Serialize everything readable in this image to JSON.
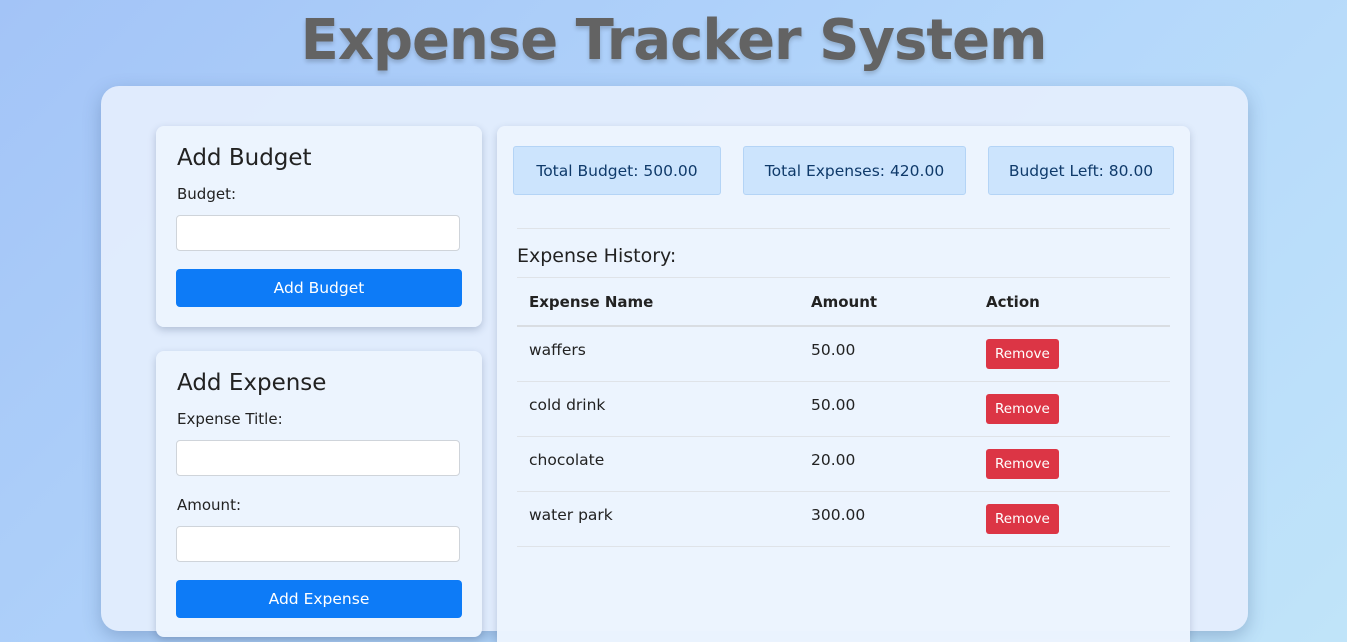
{
  "page": {
    "title": "Expense Tracker System"
  },
  "budget_form": {
    "heading": "Add Budget",
    "budget_label": "Budget:",
    "budget_value": "",
    "submit_label": "Add Budget"
  },
  "expense_form": {
    "heading": "Add Expense",
    "title_label": "Expense Title:",
    "title_value": "",
    "amount_label": "Amount:",
    "amount_value": "",
    "submit_label": "Add Expense"
  },
  "summary": {
    "total_budget": "Total Budget: 500.00",
    "total_expenses": "Total Expenses: 420.00",
    "budget_left": "Budget Left: 80.00"
  },
  "history": {
    "title": "Expense History:",
    "columns": [
      "Expense Name",
      "Amount",
      "Action"
    ],
    "rows": [
      {
        "name": "waffers",
        "amount": "50.00",
        "action": "Remove"
      },
      {
        "name": "cold drink",
        "amount": "50.00",
        "action": "Remove"
      },
      {
        "name": "chocolate",
        "amount": "20.00",
        "action": "Remove"
      },
      {
        "name": "water park",
        "amount": "300.00",
        "action": "Remove"
      }
    ]
  },
  "colors": {
    "primary": "#0d7bf7",
    "danger": "#dc3545",
    "summary_bg": "#cce4fd",
    "title_text": "#636363"
  }
}
